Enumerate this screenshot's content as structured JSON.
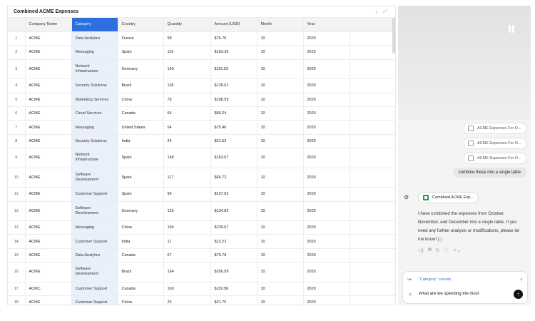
{
  "table": {
    "title": "Combined ACME Expenses",
    "headers": [
      "",
      "Company Name",
      "Category",
      "Country",
      "Quantity",
      "Amount (USD)",
      "Month",
      "Year",
      ""
    ],
    "rows": [
      {
        "i": "1",
        "company": "ACME",
        "category": "Data Analytics",
        "country": "France",
        "qty": "58",
        "amount": "$76.76",
        "month": "10",
        "year": "2020",
        "tall": false
      },
      {
        "i": "2",
        "company": "ACME",
        "category": "Messaging",
        "country": "Spain",
        "qty": "116",
        "amount": "$163.36",
        "month": "10",
        "year": "2020",
        "tall": false
      },
      {
        "i": "3",
        "company": "ACME",
        "category": "Network Infrastructure",
        "country": "Germany",
        "qty": "160",
        "amount": "$115.03",
        "month": "10",
        "year": "2020",
        "tall": true
      },
      {
        "i": "4",
        "company": "ACME",
        "category": "Security Solutions",
        "country": "Brazil",
        "qty": "118",
        "amount": "$139.61",
        "month": "10",
        "year": "2020",
        "tall": false
      },
      {
        "i": "5",
        "company": "ACME",
        "category": "Marketing Services",
        "country": "China",
        "qty": "78",
        "amount": "$108.59",
        "month": "10",
        "year": "2020",
        "tall": false
      },
      {
        "i": "6",
        "company": "ACME",
        "category": "Cloud Services",
        "country": "Canada",
        "qty": "64",
        "amount": "$89.24",
        "month": "10",
        "year": "2020",
        "tall": false
      },
      {
        "i": "7",
        "company": "ACME",
        "category": "Messaging",
        "country": "United States",
        "qty": "54",
        "amount": "$75.46",
        "month": "10",
        "year": "2020",
        "tall": false
      },
      {
        "i": "8",
        "company": "ACME",
        "category": "Security Solutions",
        "country": "India",
        "qty": "24",
        "amount": "$21.53",
        "month": "10",
        "year": "2020",
        "tall": false
      },
      {
        "i": "9",
        "company": "ACME",
        "category": "Network Infrastructure",
        "country": "Spain",
        "qty": "148",
        "amount": "$163.07",
        "month": "10",
        "year": "2020",
        "tall": true
      },
      {
        "i": "10",
        "company": "ACME",
        "category": "Software Development",
        "country": "Spain",
        "qty": "117",
        "amount": "$66.72",
        "month": "10",
        "year": "2020",
        "tall": true
      },
      {
        "i": "11",
        "company": "ACME",
        "category": "Customer Support",
        "country": "Spain",
        "qty": "99",
        "amount": "$127.82",
        "month": "10",
        "year": "2020",
        "tall": false
      },
      {
        "i": "12",
        "company": "ACME",
        "category": "Software Development",
        "country": "Germany",
        "qty": "125",
        "amount": "$134.83",
        "month": "10",
        "year": "2020",
        "tall": true
      },
      {
        "i": "13",
        "company": "ACME",
        "category": "Messaging",
        "country": "China",
        "qty": "194",
        "amount": "$239.67",
        "month": "10",
        "year": "2020",
        "tall": false
      },
      {
        "i": "14",
        "company": "ACME",
        "category": "Customer Support",
        "country": "India",
        "qty": "11",
        "amount": "$13.22",
        "month": "10",
        "year": "2020",
        "tall": false
      },
      {
        "i": "13",
        "company": "ACME",
        "category": "Data Analytics",
        "country": "Canada",
        "qty": "67",
        "amount": "$79.78",
        "month": "10",
        "year": "2020",
        "tall": false
      },
      {
        "i": "16",
        "company": "ACME",
        "category": "Software Development",
        "country": "Brazil",
        "qty": "164",
        "amount": "$206.99",
        "month": "10",
        "year": "2020",
        "tall": true
      },
      {
        "i": "17",
        "company": "ACMC",
        "category": "Customer Support",
        "country": "Canada",
        "qty": "160",
        "amount": "$119.56",
        "month": "10",
        "year": "2020",
        "tall": false
      },
      {
        "i": "18",
        "company": "ACME",
        "category": "Customer Support",
        "country": "China",
        "qty": "23",
        "amount": "$31.75",
        "month": "10",
        "year": "2020",
        "tall": false
      }
    ]
  },
  "chat": {
    "attachments": [
      "ACME Expenses For D...",
      "ACME Expenses For N...",
      "ACME Expenses For O..."
    ],
    "user_message": "combine these into a single table",
    "file_card": "Combined ACME Exp...",
    "bot_message": "I have combined the expenses from October, November, and December into a single table. If you need any further analysis or modifications, please let me know!",
    "bot_cite": "[-]",
    "reply_ref": "\"Category\" column",
    "input_value": "What are we spending the most"
  },
  "colors": {
    "accent": "#2d6fdf",
    "selected_column": "#eaf0fb",
    "file_icon": "#1e9e50"
  }
}
